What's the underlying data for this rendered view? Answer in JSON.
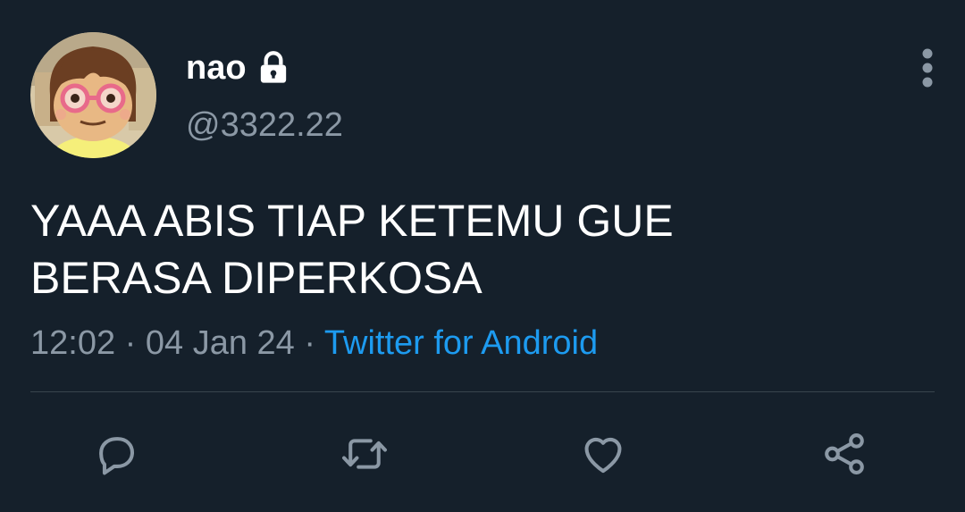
{
  "user": {
    "display_name": "nao",
    "handle": "@3322.22"
  },
  "tweet": {
    "lines": [
      "YAAA ABIS TIAP KETEMU GUE",
      "BERASA DIPERKOSA"
    ],
    "time": "12:02",
    "separator": "·",
    "date": "04 Jan 24",
    "source": "Twitter for Android"
  },
  "icons": {
    "lock": "lock-icon",
    "more": "more-vertical-icon",
    "reply": "reply-icon",
    "retweet": "retweet-icon",
    "like": "heart-icon",
    "share": "share-icon"
  },
  "colors": {
    "background": "#15202b",
    "text": "#ffffff",
    "secondary": "#8b98a5",
    "link": "#1d9bf0",
    "divider": "#38444d"
  }
}
